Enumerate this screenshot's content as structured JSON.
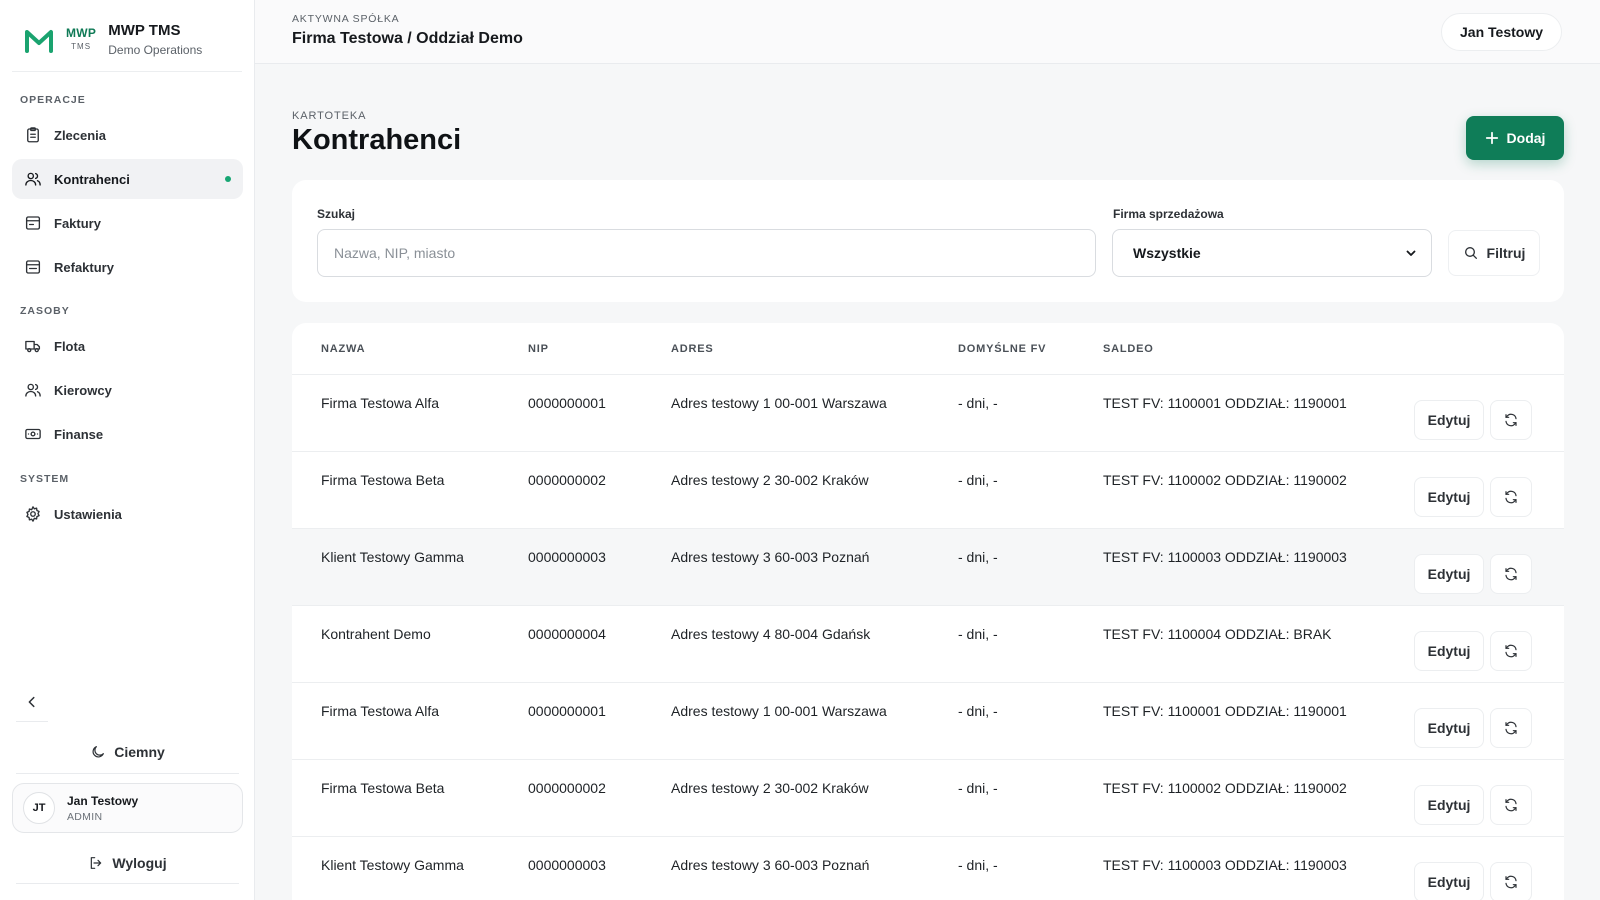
{
  "brand": {
    "mark_top": "MWP",
    "mark_bottom": "TMS",
    "title": "MWP TMS",
    "subtitle": "Demo Operations",
    "accent": "#0f7d58"
  },
  "sidebar": {
    "sections": {
      "ops": "OPERACJE",
      "resources": "ZASOBY",
      "system": "SYSTEM"
    },
    "items": [
      {
        "label": "Zlecenia",
        "icon": "clipboard-icon"
      },
      {
        "label": "Kontrahenci",
        "icon": "users-icon",
        "active": true
      },
      {
        "label": "Faktury",
        "icon": "invoice-icon"
      },
      {
        "label": "Refaktury",
        "icon": "reinvoice-icon"
      },
      {
        "label": "Flota",
        "icon": "truck-icon"
      },
      {
        "label": "Kierowcy",
        "icon": "drivers-icon"
      },
      {
        "label": "Finanse",
        "icon": "cash-icon"
      },
      {
        "label": "Ustawienia",
        "icon": "gear-icon"
      }
    ],
    "theme_label": "Ciemny",
    "user": {
      "initials": "JT",
      "name": "Jan Testowy",
      "role": "ADMIN"
    },
    "logout_label": "Wyloguj"
  },
  "topbar": {
    "company_label": "AKTYWNA SPÓŁKA",
    "company_name": "Firma Testowa / Oddział Demo",
    "user_name": "Jan Testowy"
  },
  "page": {
    "kicker": "KARTOTEKA",
    "title": "Kontrahenci",
    "add_label": "Dodaj"
  },
  "filters": {
    "search_label": "Szukaj",
    "search_placeholder": "Nazwa, NIP, miasto",
    "search_value": "",
    "company_label": "Firma sprzedażowa",
    "company_selected": "Wszystkie",
    "filter_label": "Filtruj"
  },
  "table": {
    "headers": {
      "name": "NAZWA",
      "nip": "NIP",
      "address": "ADRES",
      "default_fv": "DOMYŚLNE FV",
      "saldeo": "SALDEO"
    },
    "edit_label": "Edytuj",
    "rows": [
      {
        "name": "Firma Testowa Alfa",
        "nip": "0000000001",
        "address": "Adres testowy 1 00-001 Warszawa",
        "default_fv": "- dni, -",
        "saldeo": "TEST FV: 1100001 ODDZIAŁ: 1190001"
      },
      {
        "name": "Firma Testowa Beta",
        "nip": "0000000002",
        "address": "Adres testowy 2 30-002 Kraków",
        "default_fv": "- dni, -",
        "saldeo": "TEST FV: 1100002 ODDZIAŁ: 1190002"
      },
      {
        "name": "Klient Testowy Gamma",
        "nip": "0000000003",
        "address": "Adres testowy 3 60-003 Poznań",
        "default_fv": "- dni, -",
        "saldeo": "TEST FV: 1100003 ODDZIAŁ: 1190003"
      },
      {
        "name": "Kontrahent Demo",
        "nip": "0000000004",
        "address": "Adres testowy 4 80-004 Gdańsk",
        "default_fv": "- dni, -",
        "saldeo": "TEST FV: 1100004 ODDZIAŁ: BRAK"
      },
      {
        "name": "Firma Testowa Alfa",
        "nip": "0000000001",
        "address": "Adres testowy 1 00-001 Warszawa",
        "default_fv": "- dni, -",
        "saldeo": "TEST FV: 1100001 ODDZIAŁ: 1190001"
      },
      {
        "name": "Firma Testowa Beta",
        "nip": "0000000002",
        "address": "Adres testowy 2 30-002 Kraków",
        "default_fv": "- dni, -",
        "saldeo": "TEST FV: 1100002 ODDZIAŁ: 1190002"
      },
      {
        "name": "Klient Testowy Gamma",
        "nip": "0000000003",
        "address": "Adres testowy 3 60-003 Poznań",
        "default_fv": "- dni, -",
        "saldeo": "TEST FV: 1100003 ODDZIAŁ: 1190003"
      }
    ]
  }
}
